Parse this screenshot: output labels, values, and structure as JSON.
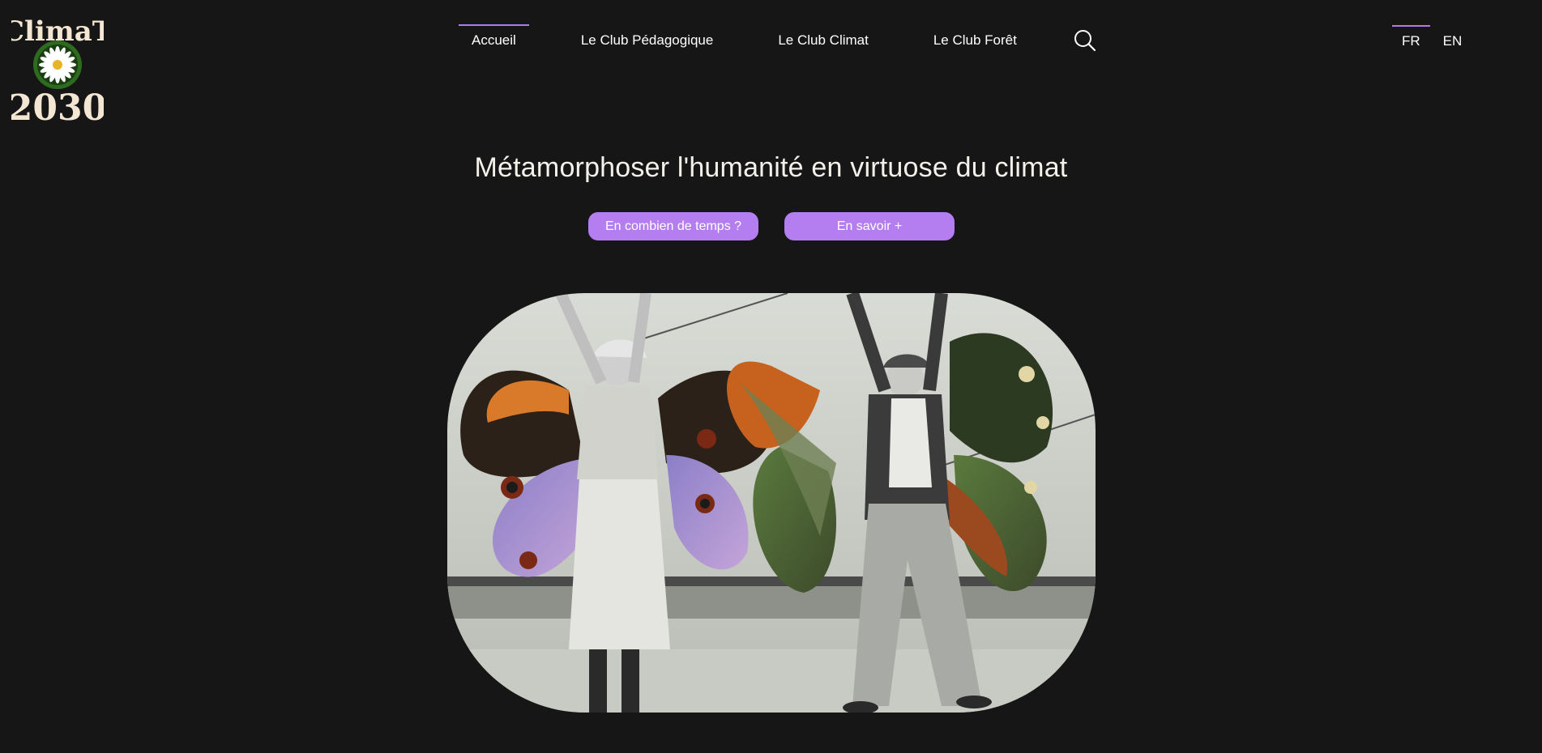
{
  "logo": {
    "top_text": "ClimaT",
    "bottom_text": "2030",
    "icon": "daisy-icon"
  },
  "nav": {
    "items": [
      {
        "label": "Accueil",
        "active": true
      },
      {
        "label": "Le Club Pédagogique",
        "active": false
      },
      {
        "label": "Le Club Climat",
        "active": false
      },
      {
        "label": "Le Club Forêt",
        "active": false
      }
    ],
    "search_icon": "search-icon"
  },
  "lang": {
    "items": [
      {
        "label": "FR",
        "active": true
      },
      {
        "label": "EN",
        "active": false
      }
    ]
  },
  "hero": {
    "title": "Métamorphoser l'humanité en virtuose du climat",
    "buttons": [
      {
        "label": "En combien de temps ?"
      },
      {
        "label": "En savoir +"
      }
    ]
  },
  "colors": {
    "background": "#161616",
    "accent": "#b57ef0",
    "title_text": "#f4f0ea",
    "logo_cream": "#f3e6d3",
    "logo_green": "#2d6b1f"
  }
}
